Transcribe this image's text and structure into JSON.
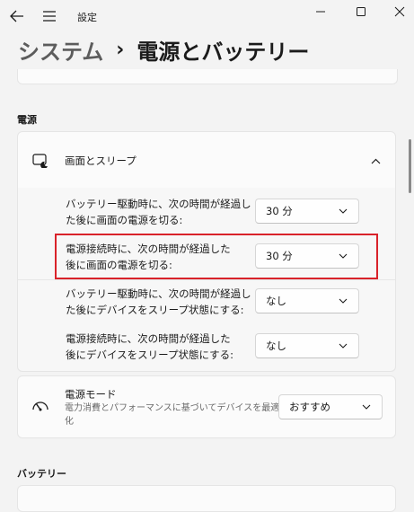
{
  "titlebar": {
    "title": "設定"
  },
  "header": {
    "parent": "システム",
    "separator": "›",
    "current": "電源とバッテリー"
  },
  "power_section": {
    "label": "電源",
    "screen_sleep": {
      "title": "画面とスリープ",
      "rows": [
        {
          "line1": "バッテリー駆動時に、次の時間が経過し",
          "line2": "た後に画面の電源を切る:",
          "value": "30 分"
        },
        {
          "line1": "電源接続時に、次の時間が経過した",
          "line2": "後に画面の電源を切る:",
          "value": "30 分"
        },
        {
          "line1": "バッテリー駆動時に、次の時間が経過し",
          "line2": "た後にデバイスをスリープ状態にする:",
          "value": "なし"
        },
        {
          "line1": "電源接続時に、次の時間が経過した",
          "line2": "後にデバイスをスリープ状態にする:",
          "value": "なし"
        }
      ]
    },
    "power_mode": {
      "title": "電源モード",
      "desc_line1": "電力消費とパフォーマンスに基づいてデバイスを最適",
      "desc_line2": "化",
      "value": "おすすめ"
    }
  },
  "battery_section": {
    "label": "バッテリー"
  },
  "colors": {
    "highlight": "#d9222a",
    "background": "#f3f3f3",
    "card": "#fbfbfb"
  }
}
